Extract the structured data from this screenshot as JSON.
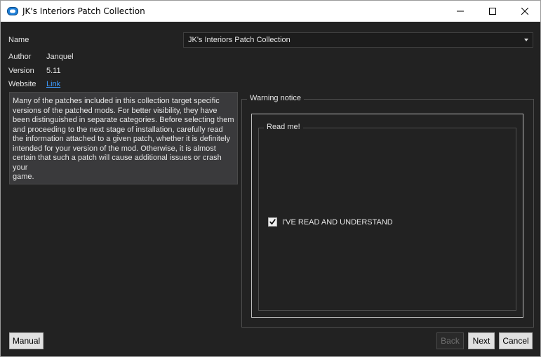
{
  "window": {
    "title": "JK's Interiors Patch Collection",
    "icon": "app-icon",
    "controls": [
      "minimize-icon",
      "maximize-icon",
      "close-icon"
    ]
  },
  "info": {
    "name_label": "Name",
    "name_value": "JK's Interiors Patch Collection",
    "author_label": "Author",
    "author_value": "Janquel",
    "version_label": "Version",
    "version_value": "5.11",
    "website_label": "Website",
    "website_link": "Link"
  },
  "description": {
    "lines": [
      "Many of the patches included in this collection target specific",
      "versions of the patched mods. For better visibility, they have",
      "been distinguished in separate categories. Before selecting them",
      "and proceeding to the next stage of installation, carefully read",
      "the information attached to a given patch, whether it is definitely",
      "intended for your version of the mod. Otherwise, it is almost",
      "certain that such a patch will cause additional issues or crash your",
      "game."
    ]
  },
  "warning": {
    "group_title": "Warning notice",
    "inner_title": "Read me!",
    "checkbox_label": "I'VE READ AND UNDERSTAND",
    "checkbox_checked": true
  },
  "buttons": {
    "manual": "Manual",
    "back": "Back",
    "next": "Next",
    "cancel": "Cancel"
  },
  "colors": {
    "background": "#222222",
    "link": "#3d9bff",
    "text": "#e6e6e6"
  }
}
